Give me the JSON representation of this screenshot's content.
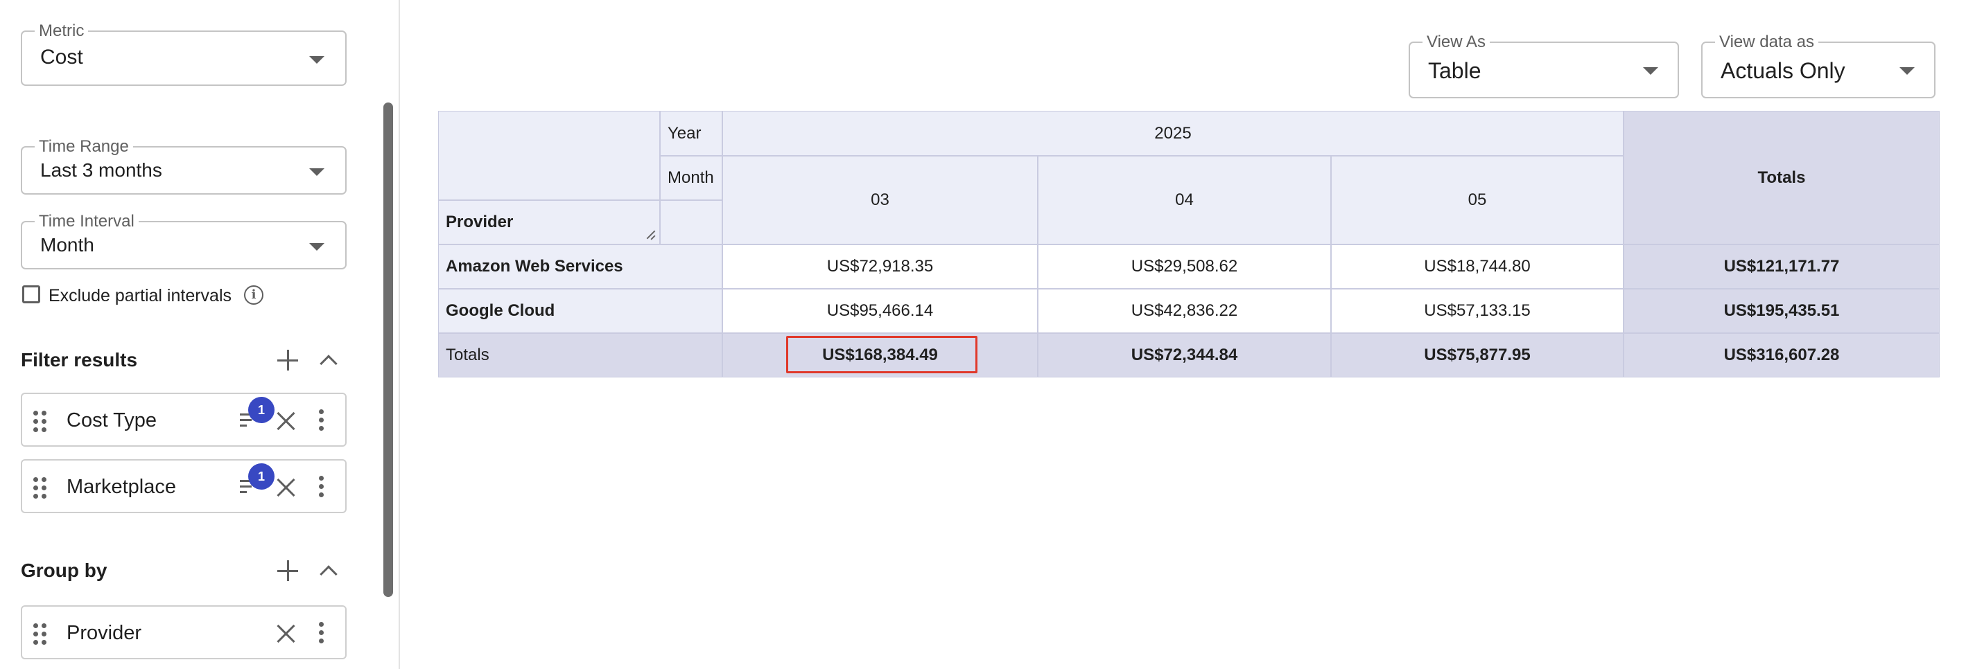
{
  "sidebar": {
    "metric": {
      "label": "Metric",
      "value": "Cost"
    },
    "time_range": {
      "label": "Time Range",
      "value": "Last 3 months"
    },
    "time_interval": {
      "label": "Time Interval",
      "value": "Month"
    },
    "exclude_partial": {
      "label": "Exclude partial intervals",
      "checked": false
    },
    "filter_results": {
      "title": "Filter results",
      "items": [
        {
          "name": "Cost Type",
          "badge": "1"
        },
        {
          "name": "Marketplace",
          "badge": "1"
        }
      ]
    },
    "group_by": {
      "title": "Group by",
      "items": [
        {
          "name": "Provider"
        }
      ]
    }
  },
  "main": {
    "view_as": {
      "label": "View As",
      "value": "Table"
    },
    "view_data_as": {
      "label": "View data as",
      "value": "Actuals Only"
    },
    "pivot": {
      "year_label": "Year",
      "month_label": "Month",
      "row_header": "Provider",
      "year": "2025",
      "months": [
        "03",
        "04",
        "05"
      ],
      "totals_label": "Totals",
      "rows": [
        {
          "provider": "Amazon Web Services",
          "values": [
            "US$72,918.35",
            "US$29,508.62",
            "US$18,744.80"
          ],
          "total": "US$121,171.77"
        },
        {
          "provider": "Google Cloud",
          "values": [
            "US$95,466.14",
            "US$42,836.22",
            "US$57,133.15"
          ],
          "total": "US$195,435.51"
        }
      ],
      "totals_row": {
        "label": "Totals",
        "values": [
          "US$168,384.49",
          "US$72,344.84",
          "US$75,877.95"
        ],
        "total": "US$316,607.28"
      }
    }
  },
  "colors": {
    "accent_badge": "#3848c2",
    "header_bg": "#eceef8",
    "totals_bg": "#d8d9ea",
    "highlight_border": "#e0392b"
  }
}
